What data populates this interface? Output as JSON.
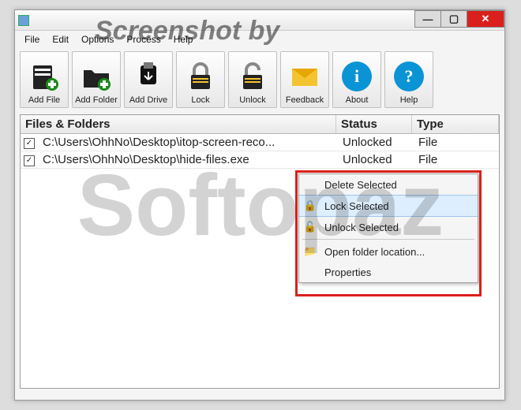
{
  "watermark": {
    "caption": "Screenshot by",
    "logo_text": "Softopaz"
  },
  "window": {
    "controls": {
      "min": "—",
      "max": "▢",
      "close": "✕"
    }
  },
  "menubar": [
    "File",
    "Edit",
    "Options",
    "Process",
    "Help"
  ],
  "toolbar": [
    {
      "label": "Add File",
      "name": "add-file-button"
    },
    {
      "label": "Add Folder",
      "name": "add-folder-button"
    },
    {
      "label": "Add Drive",
      "name": "add-drive-button"
    },
    {
      "label": "Lock",
      "name": "lock-button"
    },
    {
      "label": "Unlock",
      "name": "unlock-button"
    },
    {
      "label": "Feedback",
      "name": "feedback-button"
    },
    {
      "label": "About",
      "name": "about-button"
    },
    {
      "label": "Help",
      "name": "help-button"
    }
  ],
  "columns": {
    "path": "Files & Folders",
    "status": "Status",
    "type": "Type"
  },
  "rows": [
    {
      "checked": true,
      "path": "C:\\Users\\OhhNo\\Desktop\\itop-screen-reco...",
      "status": "Unlocked",
      "type": "File"
    },
    {
      "checked": true,
      "path": "C:\\Users\\OhhNo\\Desktop\\hide-files.exe",
      "status": "Unlocked",
      "type": "File"
    }
  ],
  "context_menu": {
    "items": [
      {
        "label": "Delete Selected",
        "icon": "",
        "name": "ctx-delete"
      },
      {
        "label": "Lock Selected",
        "icon": "lock",
        "name": "ctx-lock",
        "hover": true
      },
      {
        "label": "Unlock Selected",
        "icon": "unlock",
        "name": "ctx-unlock"
      },
      {
        "sep": true
      },
      {
        "label": "Open folder location...",
        "icon": "folder",
        "name": "ctx-open-location"
      },
      {
        "label": "Properties",
        "icon": "",
        "name": "ctx-properties"
      }
    ]
  }
}
